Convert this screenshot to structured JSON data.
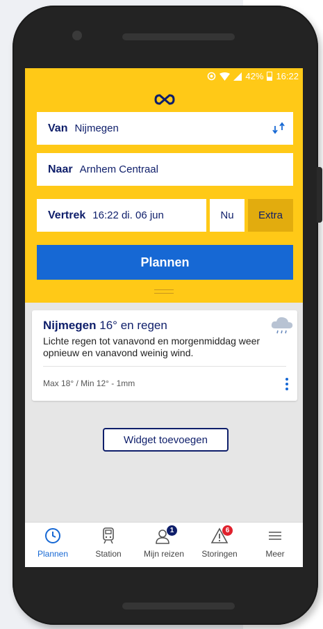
{
  "status_bar": {
    "battery": "42%",
    "time": "16:22"
  },
  "planner": {
    "van_label": "Van",
    "van_value": "Nijmegen",
    "naar_label": "Naar",
    "naar_value": "Arnhem Centraal",
    "vertrek_label": "Vertrek",
    "vertrek_value": "16:22 di. 06 jun",
    "nu_label": "Nu",
    "extra_label": "Extra",
    "plannen_label": "Plannen"
  },
  "weather": {
    "city": "Nijmegen",
    "summary": "16° en regen",
    "description": "Lichte regen tot vanavond en morgenmiddag weer opnieuw en vanavond weinig wind.",
    "details": "Max 18° / Min 12° - 1mm",
    "icon": "rain-cloud-icon"
  },
  "widget_button_label": "Widget toevoegen",
  "nav": {
    "items": [
      {
        "label": "Plannen",
        "icon": "clock-icon",
        "active": true
      },
      {
        "label": "Station",
        "icon": "train-icon"
      },
      {
        "label": "Mijn reizen",
        "icon": "user-icon",
        "badge": "1"
      },
      {
        "label": "Storingen",
        "icon": "warning-icon",
        "badge": "6"
      },
      {
        "label": "Meer",
        "icon": "menu-icon"
      }
    ]
  },
  "colors": {
    "header_yellow": "#ffc917",
    "ns_blue": "#0e1e6a",
    "action_blue": "#1668d4",
    "extra_button": "#e2ac0e",
    "badge_blue": "#0e1e6a",
    "badge_red": "#e0212d"
  }
}
